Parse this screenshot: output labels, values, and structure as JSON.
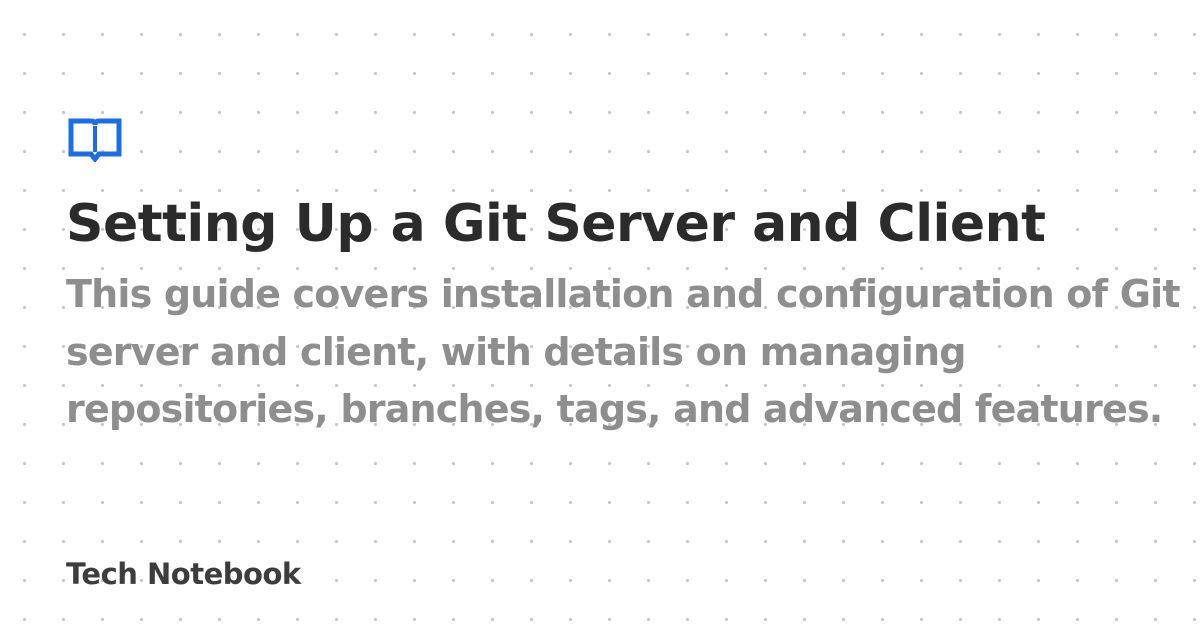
{
  "card": {
    "title": "Setting Up a Git Server and Client",
    "description": "This guide covers installation and configuration of Git server and client, with details on managing repositories, branches, tags, and advanced features.",
    "site_name": "Tech Notebook"
  },
  "logo": {
    "icon": "open-book-icon",
    "color": "#1a6fe8"
  },
  "colors": {
    "background": "#ffffff",
    "dots": "#c8c8c8",
    "title": "#2b2b2b",
    "description": "#8e8e8e",
    "brand": "#3d3d3d"
  }
}
